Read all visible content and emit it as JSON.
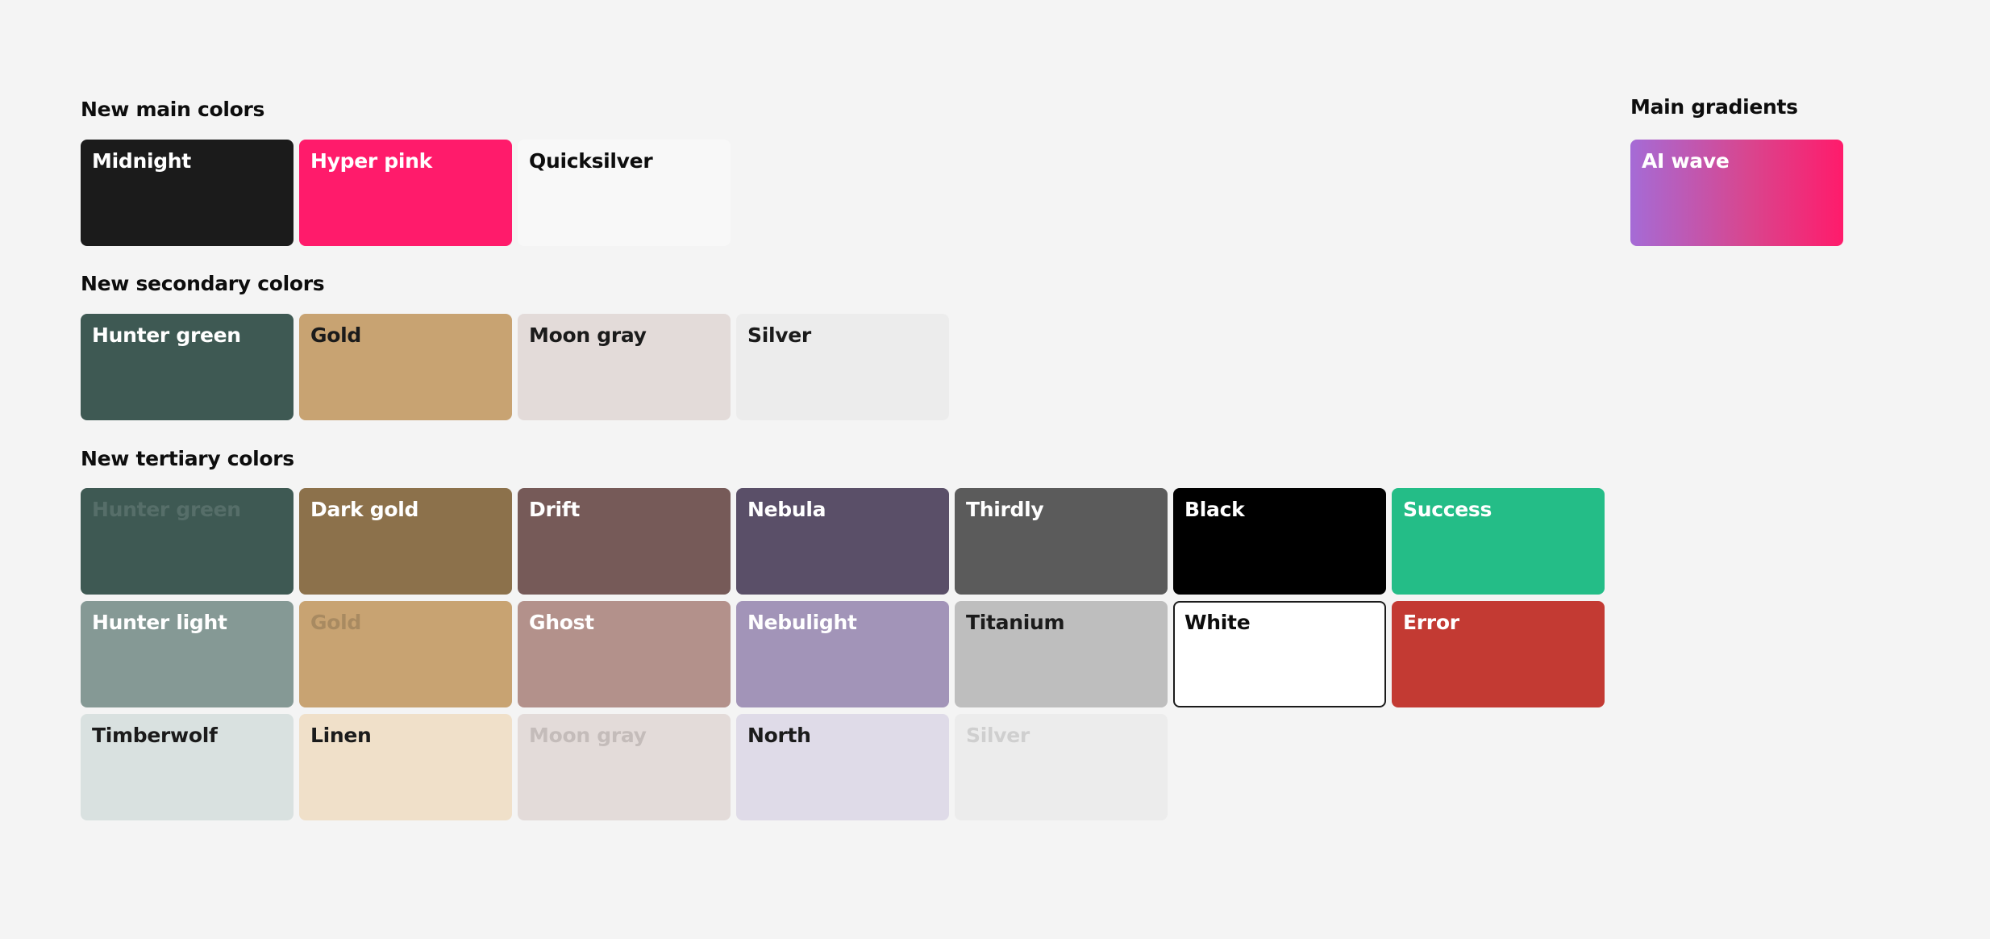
{
  "sections": {
    "main": {
      "title": "New main colors",
      "swatches": [
        {
          "label": "Midnight",
          "color": "#1b1b1b",
          "text_color": "#ffffff"
        },
        {
          "label": "Hyper pink",
          "color": "#ff1b6b",
          "text_color": "#ffffff"
        },
        {
          "label": "Quicksilver",
          "color": "#f8f8f8",
          "text_color": "#0d0d0d"
        }
      ]
    },
    "secondary": {
      "title": "New secondary colors",
      "swatches": [
        {
          "label": "Hunter green",
          "color": "#3e5953",
          "text_color": "#ffffff"
        },
        {
          "label": "Gold",
          "color": "#c8a372",
          "text_color": "#1b1b1b"
        },
        {
          "label": "Moon gray",
          "color": "#e3dbd9",
          "text_color": "#1b1b1b"
        },
        {
          "label": "Silver",
          "color": "#ececec",
          "text_color": "#1b1b1b"
        }
      ]
    },
    "tertiary": {
      "title": "New tertiary colors",
      "rows": [
        [
          {
            "label": "Hunter green",
            "color": "#3e5953",
            "text_color": "#566e69"
          },
          {
            "label": "Dark gold",
            "color": "#8c714b",
            "text_color": "#ffffff"
          },
          {
            "label": "Drift",
            "color": "#765a58",
            "text_color": "#ffffff"
          },
          {
            "label": "Nebula",
            "color": "#5a4f68",
            "text_color": "#ffffff"
          },
          {
            "label": "Thirdly",
            "color": "#5b5b5b",
            "text_color": "#ffffff"
          },
          {
            "label": "Black",
            "color": "#000000",
            "text_color": "#ffffff"
          },
          {
            "label": "Success",
            "color": "#24bd87",
            "text_color": "#ffffff"
          }
        ],
        [
          {
            "label": "Hunter light",
            "color": "#859995",
            "text_color": "#ffffff"
          },
          {
            "label": "Gold",
            "color": "#c8a372",
            "text_color": "#a88a61"
          },
          {
            "label": "Ghost",
            "color": "#b3918b",
            "text_color": "#ffffff"
          },
          {
            "label": "Nebulight",
            "color": "#a294b8",
            "text_color": "#ffffff"
          },
          {
            "label": "Titanium",
            "color": "#bebebe",
            "text_color": "#1b1b1b"
          },
          {
            "label": "White",
            "color": "#ffffff",
            "text_color": "#0d0d0d",
            "outlined": true
          },
          {
            "label": "Error",
            "color": "#c33a33",
            "text_color": "#ffffff"
          }
        ],
        [
          {
            "label": "Timberwolf",
            "color": "#d9e1e0",
            "text_color": "#1b1b1b"
          },
          {
            "label": "Linen",
            "color": "#f0e0c9",
            "text_color": "#1b1b1b"
          },
          {
            "label": "Moon gray",
            "color": "#e3dbd9",
            "text_color": "#c4bcba"
          },
          {
            "label": "North",
            "color": "#dfdbe8",
            "text_color": "#1b1b1b"
          },
          {
            "label": "Silver",
            "color": "#ececec",
            "text_color": "#cfcfcf"
          }
        ]
      ]
    },
    "gradients": {
      "title": "Main gradients",
      "swatches": [
        {
          "label": "AI wave",
          "gradient_from": "#a56bd6",
          "gradient_via": "#d8468f",
          "gradient_to": "#ff1b6b",
          "text_color": "#ffffff"
        }
      ]
    }
  }
}
